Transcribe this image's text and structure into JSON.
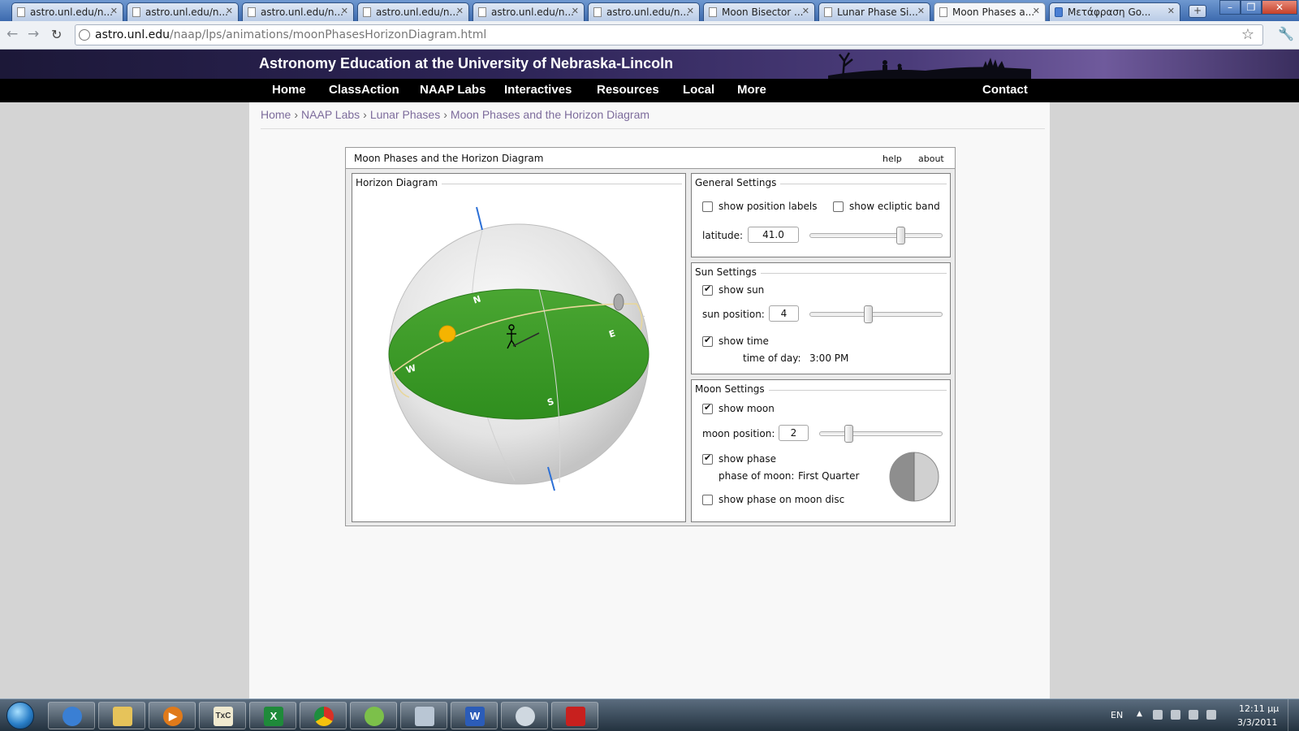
{
  "browser": {
    "tabs": [
      {
        "label": "astro.unl.edu/n...",
        "active": false,
        "icon": "page-icon"
      },
      {
        "label": "astro.unl.edu/n...",
        "active": false,
        "icon": "page-icon"
      },
      {
        "label": "astro.unl.edu/n...",
        "active": false,
        "icon": "page-icon"
      },
      {
        "label": "astro.unl.edu/n...",
        "active": false,
        "icon": "page-icon"
      },
      {
        "label": "astro.unl.edu/n...",
        "active": false,
        "icon": "page-icon"
      },
      {
        "label": "astro.unl.edu/n...",
        "active": false,
        "icon": "page-icon"
      },
      {
        "label": "Moon Bisector ...",
        "active": false,
        "icon": "page-icon"
      },
      {
        "label": "Lunar Phase Si...",
        "active": false,
        "icon": "page-icon"
      },
      {
        "label": "Moon Phases a...",
        "active": true,
        "icon": "page-icon"
      },
      {
        "label": "Μετάφραση Go...",
        "active": false,
        "icon": "translate-icon"
      }
    ],
    "url_host": "astro.unl.edu",
    "url_path": "/naap/lps/animations/moonPhasesHorizonDiagram.html"
  },
  "site": {
    "title": "Astronomy Education at the University of Nebraska-Lincoln",
    "menu": [
      "Home",
      "ClassAction",
      "NAAP Labs",
      "Interactives",
      "Resources",
      "Local",
      "More"
    ],
    "menu_right": "Contact",
    "breadcrumb": [
      "Home",
      "NAAP Labs",
      "Lunar Phases",
      "Moon Phases and the Horizon Diagram"
    ],
    "breadcrumb_sep": "›"
  },
  "app": {
    "title": "Moon Phases and the Horizon Diagram",
    "help": "help",
    "about": "about",
    "horizon": {
      "title": "Horizon Diagram",
      "directions": {
        "n": "N",
        "e": "E",
        "s": "S",
        "w": "W"
      }
    },
    "general": {
      "title": "General Settings",
      "show_position_labels": {
        "label": "show position labels",
        "checked": false
      },
      "show_ecliptic_band": {
        "label": "show ecliptic band",
        "checked": false
      },
      "latitude_label": "latitude:",
      "latitude_value": "41.0",
      "latitude_fraction": 0.7
    },
    "sun": {
      "title": "Sun Settings",
      "show_sun": {
        "label": "show sun",
        "checked": true
      },
      "position_label": "sun position:",
      "position_value": "4",
      "position_fraction": 0.44,
      "show_time": {
        "label": "show time",
        "checked": true
      },
      "time_label": "time of day:",
      "time_value": "3:00 PM"
    },
    "moon": {
      "title": "Moon Settings",
      "show_moon": {
        "label": "show moon",
        "checked": true
      },
      "position_label": "moon position:",
      "position_value": "2",
      "position_fraction": 0.22,
      "show_phase": {
        "label": "show phase",
        "checked": true
      },
      "phase_label": "phase of moon:",
      "phase_value": "First Quarter",
      "show_phase_on_disc": {
        "label": "show phase on moon disc",
        "checked": false
      }
    }
  },
  "taskbar": {
    "apps": [
      "internet-explorer-icon",
      "file-explorer-icon",
      "media-player-icon",
      "txc-icon",
      "excel-icon",
      "chrome-icon",
      "app-icon",
      "calculator-icon",
      "word-icon",
      "paint-icon",
      "acrobat-icon"
    ],
    "app_glyphs": [
      "",
      "",
      "▶",
      "TxC",
      "X",
      "",
      "",
      "",
      "W",
      "",
      ""
    ],
    "lang": "EN",
    "time": "12:11 μμ",
    "date": "3/3/2011"
  },
  "colors": {
    "ground": "#3f9e2a",
    "sun": "#f5b400",
    "axis": "#2b6fd6",
    "banner": "#2e2558"
  }
}
